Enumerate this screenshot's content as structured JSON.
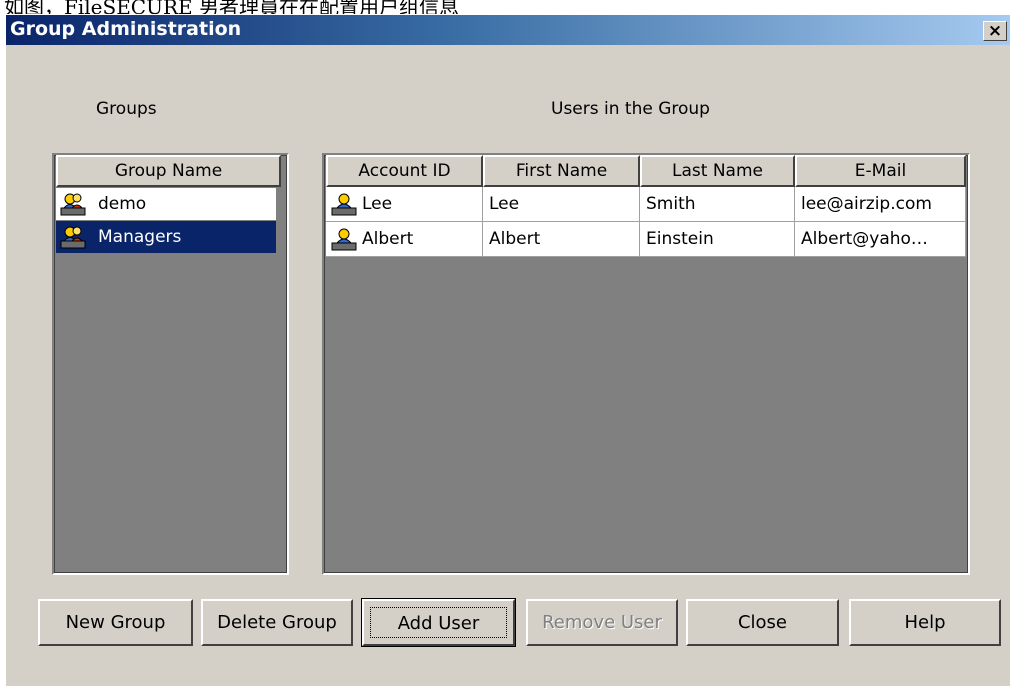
{
  "caption": "如图，FileSECURE 男者理員在在配置用户组信息",
  "window": {
    "title": "Group Administration",
    "close_glyph": "×"
  },
  "groups_label": "Groups",
  "users_label": "Users in the Group",
  "groups_table": {
    "header": "Group Name",
    "items": [
      {
        "name": "demo",
        "icon": "user-group-icon",
        "selected": false
      },
      {
        "name": "Managers",
        "icon": "user-group-icon",
        "selected": true
      }
    ]
  },
  "users_table": {
    "headers": [
      "Account ID",
      "First Name",
      "Last Name",
      "E-Mail"
    ],
    "rows": [
      {
        "account_id": "Lee",
        "first_name": "Lee",
        "last_name": "Smith",
        "email": "lee@airzip.com",
        "icon": "user-icon"
      },
      {
        "account_id": "Albert",
        "first_name": "Albert",
        "last_name": "Einstein",
        "email": "Albert@yaho…",
        "icon": "user-icon"
      }
    ]
  },
  "buttons": {
    "new_group": "New Group",
    "delete_group": "Delete Group",
    "add_user": "Add User",
    "remove_user": "Remove User",
    "close": "Close",
    "help": "Help"
  },
  "colors": {
    "dialog_face": "#d4d0c8",
    "title_gradient_start": "#0a246a",
    "selection": "#0a246a",
    "list_background": "#808080"
  }
}
